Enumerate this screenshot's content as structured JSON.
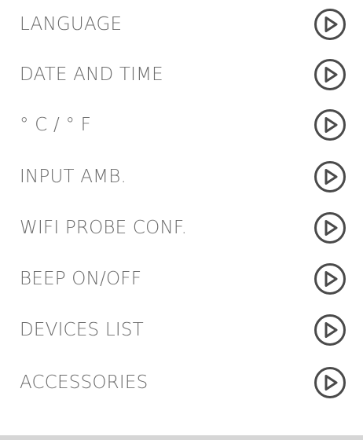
{
  "menu": {
    "items": [
      {
        "label": "LANGUAGE",
        "icon": "play-circle-icon"
      },
      {
        "label": "DATE AND TIME",
        "icon": "play-circle-icon"
      },
      {
        "label": "° C / ° F",
        "icon": "play-circle-icon"
      },
      {
        "label": "INPUT AMB.",
        "icon": "play-circle-icon"
      },
      {
        "label": "WIFI PROBE CONF.",
        "icon": "play-circle-icon"
      },
      {
        "label": "BEEP ON/OFF",
        "icon": "play-circle-icon"
      },
      {
        "label": "DEVICES LIST",
        "icon": "play-circle-icon"
      },
      {
        "label": "ACCESSORIES",
        "icon": "play-circle-icon"
      }
    ]
  },
  "colors": {
    "text": "#6b6b6b",
    "icon_stroke": "#4a4a4a",
    "background": "#ffffff",
    "bottom_bar": "#d6d6d6"
  }
}
